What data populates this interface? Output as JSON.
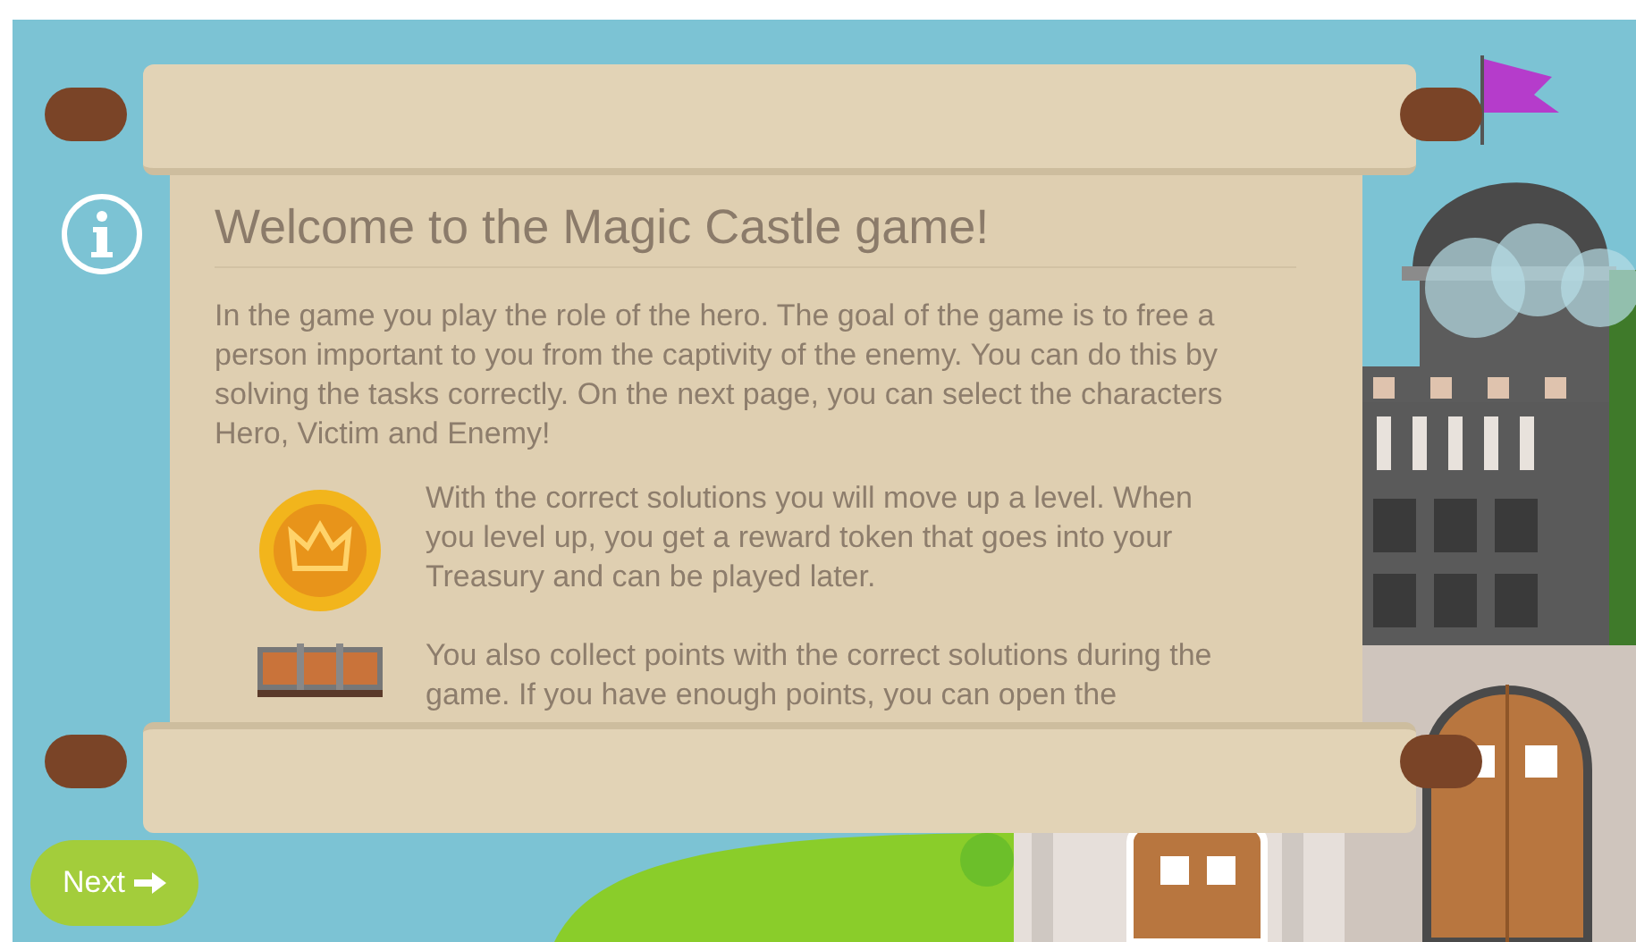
{
  "title": "Welcome to the Magic Castle game!",
  "intro": "In the game you play the role of the hero. The goal of the game is to free a person important to you from the captivity of the enemy. You can do this by solving the tasks correctly. On the next page, you can select the characters Hero, Victim and Enemy!",
  "items": [
    {
      "kind": "coin",
      "text": "With the correct solutions you will move up a level. When you level up, you get a reward token that goes into your Treasury and can be played later."
    },
    {
      "kind": "chest",
      "text": "You also collect points with the correct solutions during the game. If you have enough points, you can open the"
    }
  ],
  "next_button": {
    "label": "Next"
  }
}
